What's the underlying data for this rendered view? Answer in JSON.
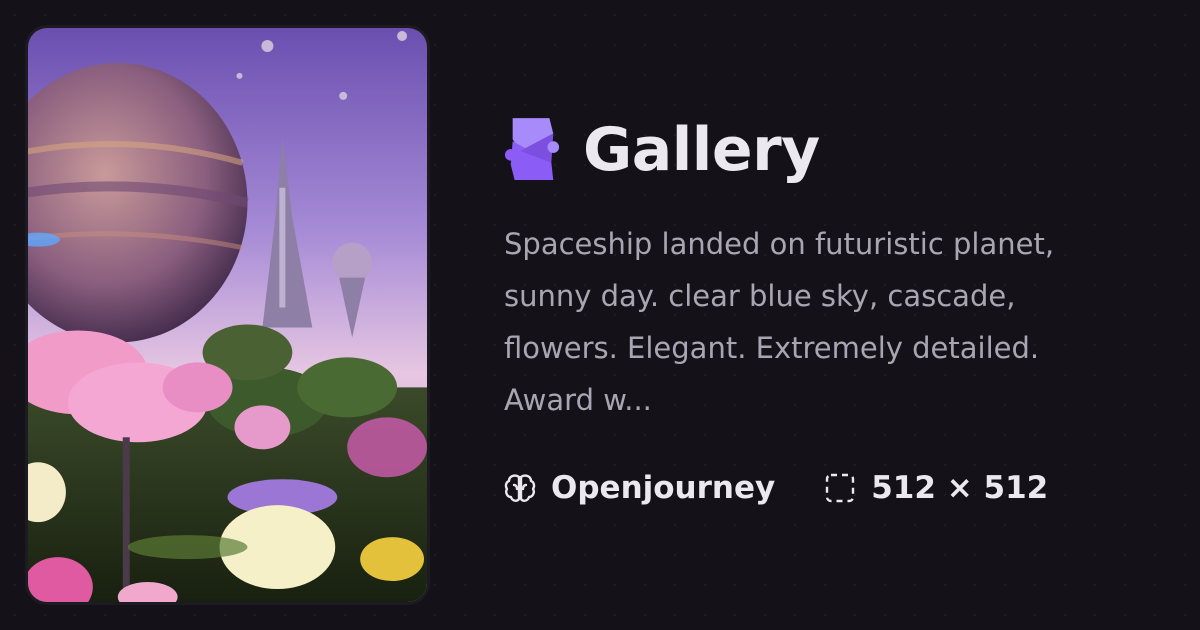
{
  "header": {
    "title": "Gallery",
    "logo_icon": "puzzle-s-logo-icon",
    "logo_colors": [
      "#a78bfa",
      "#8b5cf6"
    ]
  },
  "image": {
    "subject": "futuristic planet with spaceship and pink trees"
  },
  "prompt": {
    "text": "Spaceship landed on futuristic planet, sunny day. clear blue sky, cascade, flowers. Elegant. Extremely detailed. Award w..."
  },
  "meta": {
    "model_icon": "brain-icon",
    "model": "Openjourney",
    "size_icon": "dashed-frame-icon",
    "dimensions": "512 × 512"
  },
  "colors": {
    "background": "#141218",
    "title": "#ebe8f0",
    "prompt_text": "#a9a6b3"
  }
}
